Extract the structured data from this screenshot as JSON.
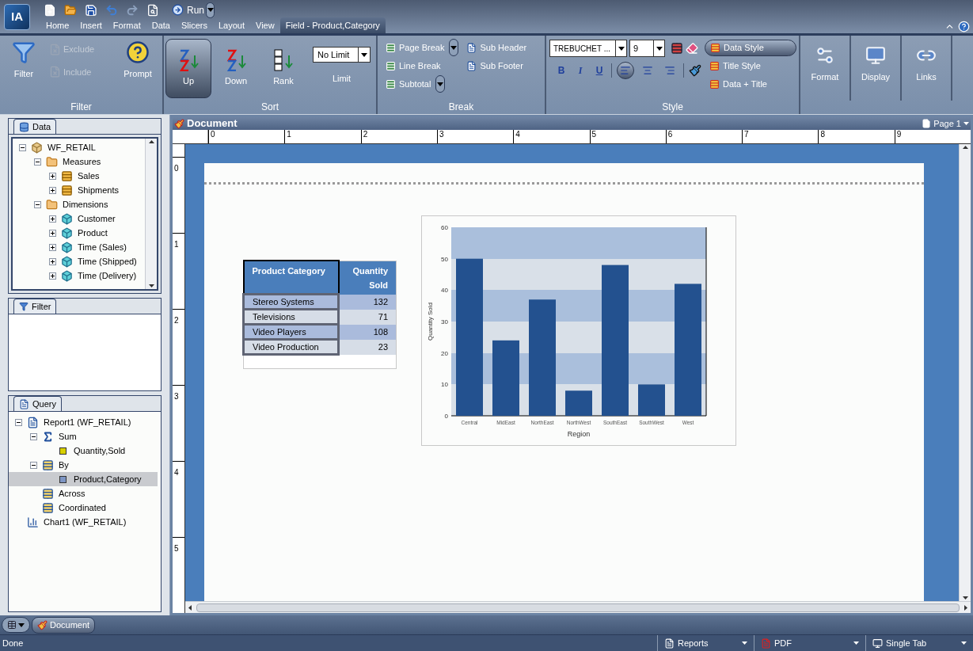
{
  "logo": "IA",
  "quick_toolbar": {
    "run": "Run"
  },
  "menu_tabs": [
    {
      "label": "Home",
      "selected": false
    },
    {
      "label": "Insert",
      "selected": false
    },
    {
      "label": "Format",
      "selected": false
    },
    {
      "label": "Data",
      "selected": false
    },
    {
      "label": "Slicers",
      "selected": false
    },
    {
      "label": "Layout",
      "selected": false
    },
    {
      "label": "View",
      "selected": false
    },
    {
      "label": "Field - Product,Category",
      "selected": true
    }
  ],
  "ribbon": {
    "filter_group": {
      "label": "Filter",
      "filter": {
        "label": "Filter",
        "disabled": false
      },
      "exclude": {
        "label": "Exclude",
        "disabled": true
      },
      "include": {
        "label": "Include",
        "disabled": true
      },
      "prompt": {
        "label": "Prompt",
        "disabled": false
      }
    },
    "sort_group": {
      "label": "Sort",
      "buttons": [
        {
          "label": "Up",
          "kind": "az",
          "selected": true
        },
        {
          "label": "Down",
          "kind": "za",
          "selected": false
        },
        {
          "label": "Rank",
          "kind": "rank",
          "selected": false
        }
      ],
      "limit": {
        "value": "No Limit",
        "label": "Limit"
      }
    },
    "break_group": {
      "label": "Break",
      "items": [
        {
          "label": "Page Break",
          "dropdown": true
        },
        {
          "label": "Line Break",
          "dropdown": false
        },
        {
          "label": "Subtotal",
          "dropdown": true
        }
      ],
      "items_right": [
        {
          "label": "Sub Header"
        },
        {
          "label": "Sub Footer"
        }
      ]
    },
    "style_group": {
      "label": "Style",
      "font": "TREBUCHET ...",
      "size": "9",
      "format_buttons": [
        {
          "label": "B",
          "kind": "bold"
        },
        {
          "label": "I",
          "kind": "italic"
        },
        {
          "label": "U",
          "kind": "underline"
        }
      ],
      "align": [
        {
          "kind": "left",
          "selected": true
        },
        {
          "kind": "center",
          "selected": false
        },
        {
          "kind": "right",
          "selected": false
        }
      ],
      "targets": [
        {
          "label": "Data Style",
          "selected": true
        },
        {
          "label": "Title Style",
          "selected": false
        },
        {
          "label": "Data + Title",
          "selected": false
        }
      ]
    },
    "extra": [
      {
        "label": "Format"
      },
      {
        "label": "Display"
      },
      {
        "label": "Links"
      }
    ]
  },
  "data_panel": {
    "title": "Data",
    "tree": [
      {
        "label": "WF_RETAIL",
        "kind": "cube",
        "expanded": true,
        "children": [
          {
            "label": "Measures",
            "kind": "folder",
            "expanded": true,
            "children": [
              {
                "label": "Sales",
                "kind": "measure",
                "expanded": false
              },
              {
                "label": "Shipments",
                "kind": "measure",
                "expanded": false
              }
            ]
          },
          {
            "label": "Dimensions",
            "kind": "folder",
            "expanded": true,
            "children": [
              {
                "label": "Customer",
                "kind": "dimension",
                "expanded": false
              },
              {
                "label": "Product",
                "kind": "dimension",
                "expanded": false
              },
              {
                "label": "Time (Sales)",
                "kind": "dimension",
                "expanded": false
              },
              {
                "label": "Time (Shipped)",
                "kind": "dimension",
                "expanded": false
              },
              {
                "label": "Time (Delivery)",
                "kind": "dimension",
                "expanded": false
              }
            ]
          }
        ]
      }
    ]
  },
  "filter_panel": {
    "title": "Filter"
  },
  "query_panel": {
    "title": "Query",
    "tree": [
      {
        "label": "Report1 (WF_RETAIL)",
        "kind": "report",
        "expanded": true,
        "selected": false,
        "children": [
          {
            "label": "Sum",
            "kind": "sum",
            "expanded": true,
            "selected": false,
            "children": [
              {
                "label": "Quantity,Sold",
                "kind": "measure_field",
                "selected": false
              }
            ]
          },
          {
            "label": "By",
            "kind": "grid",
            "expanded": true,
            "selected": false,
            "children": [
              {
                "label": "Product,Category",
                "kind": "dimension_field",
                "selected": true
              }
            ]
          },
          {
            "label": "Across",
            "kind": "grid",
            "selected": false
          },
          {
            "label": "Coordinated",
            "kind": "grid",
            "selected": false
          }
        ]
      },
      {
        "label": "Chart1 (WF_RETAIL)",
        "kind": "chart",
        "selected": false
      }
    ]
  },
  "document": {
    "title": "Document",
    "page": "Page 1",
    "ruler_h": [
      "0",
      "1",
      "2",
      "3",
      "4",
      "5",
      "6",
      "7",
      "8",
      "9"
    ],
    "ruler_v": [
      "0",
      "1",
      "2",
      "3",
      "4",
      "5"
    ],
    "table": {
      "columns": [
        {
          "label": "Product Category",
          "selected": true
        },
        {
          "label": "Quantity Sold",
          "selected": false
        }
      ],
      "rows": [
        [
          "Stereo Systems",
          "132"
        ],
        [
          "Televisions",
          "71"
        ],
        [
          "Video Players",
          "108"
        ],
        [
          "Video Production",
          "23"
        ]
      ]
    },
    "chart_data": {
      "type": "bar",
      "xlabel": "Region",
      "ylabel": "Quantity Sold",
      "categories": [
        "Central",
        "MidEast",
        "NorthEast",
        "NorthWest",
        "SouthEast",
        "SouthWest",
        "West"
      ],
      "series": [
        {
          "color": "#23518f",
          "values": [
            50,
            24,
            37,
            8,
            48,
            10,
            42
          ]
        }
      ],
      "ylim": [
        0,
        60
      ],
      "yticks": [
        0,
        10,
        20,
        30,
        40,
        50,
        60
      ]
    }
  },
  "bottom_tabs": [
    {
      "label": "Document",
      "selected": true
    }
  ],
  "status_bar": {
    "text": "Done",
    "reports": "Reports",
    "pdf": "PDF",
    "layout": "Single Tab"
  }
}
